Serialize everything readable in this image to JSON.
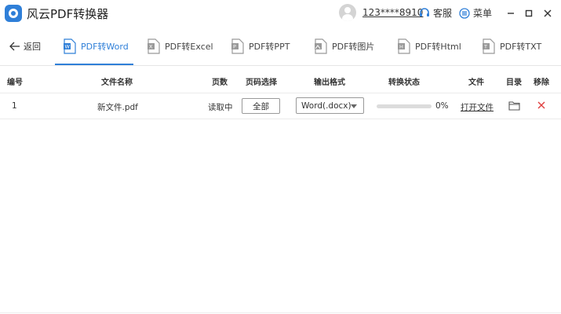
{
  "app": {
    "title": "风云PDF转换器",
    "user": "123****8910",
    "support_label": "客服",
    "menu_label": "菜单",
    "accent_color": "#2f7fd8"
  },
  "nav": {
    "back_label": "返回",
    "tabs": [
      {
        "label": "PDF转Word",
        "active": true
      },
      {
        "label": "PDF转Excel",
        "active": false
      },
      {
        "label": "PDF转PPT",
        "active": false
      },
      {
        "label": "PDF转图片",
        "active": false
      },
      {
        "label": "PDF转Html",
        "active": false
      },
      {
        "label": "PDF转TXT",
        "active": false
      }
    ]
  },
  "table": {
    "headers": {
      "index": "编号",
      "filename": "文件名称",
      "pages": "页数",
      "page_select": "页码选择",
      "output_format": "输出格式",
      "status": "转换状态",
      "file": "文件",
      "folder": "目录",
      "remove": "移除"
    },
    "rows": [
      {
        "index": "1",
        "filename": "新文件.pdf",
        "pages": "读取中",
        "page_select": "全部",
        "output_format": "Word(.docx)",
        "progress_percent": "0%",
        "progress_value": 0,
        "open_file": "打开文件"
      }
    ]
  }
}
